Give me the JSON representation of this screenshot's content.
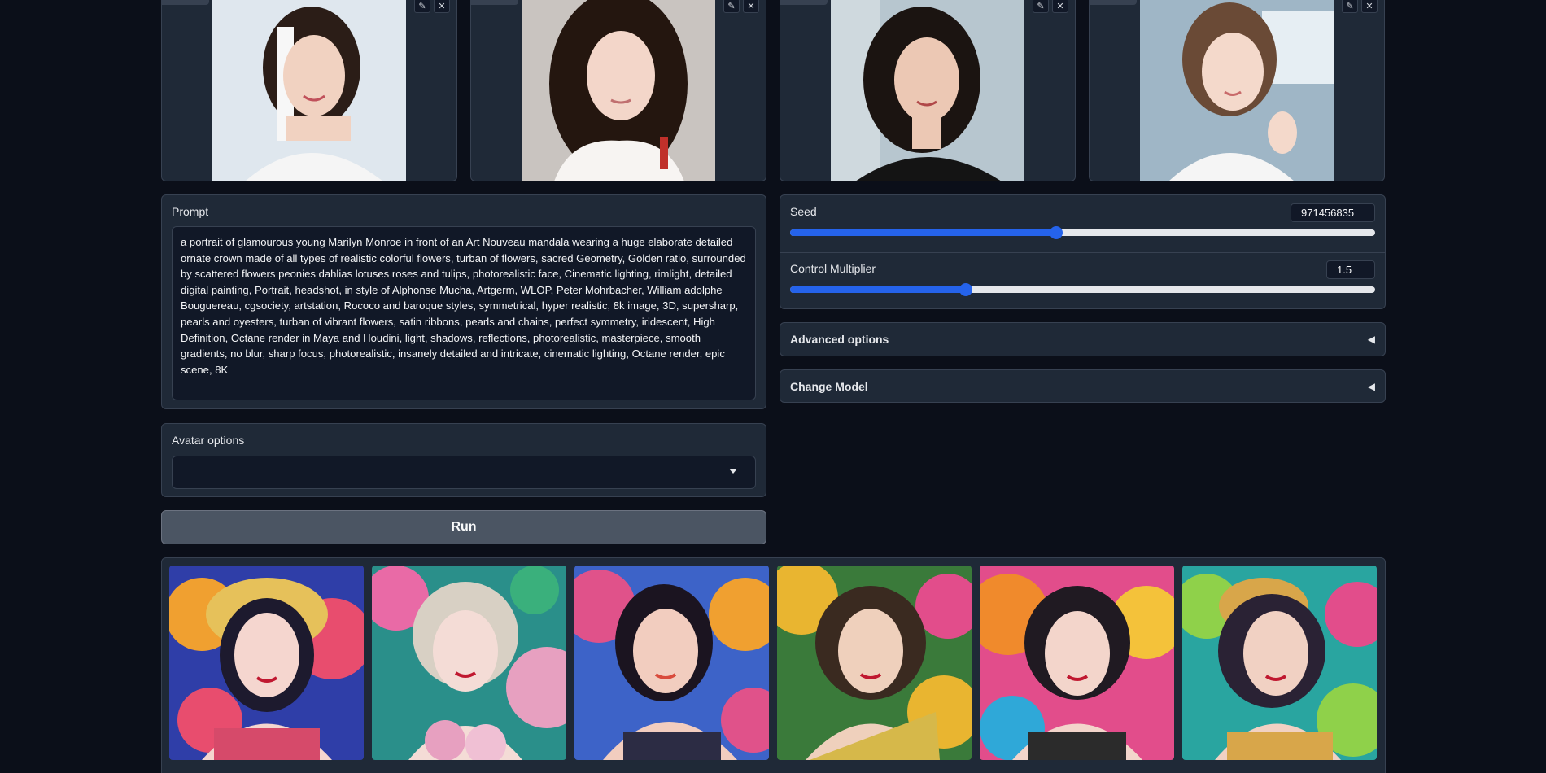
{
  "input_images": [
    {
      "name": "input-photo-1",
      "bg": "#dfe7ee",
      "hair": "#2b1d17",
      "skin": "#f1d2c1",
      "cloth": "#f5f5f5"
    },
    {
      "name": "input-photo-2",
      "bg": "#c9c4c0",
      "hair": "#24160f",
      "skin": "#f3d6c9",
      "cloth": "#f7f4f2"
    },
    {
      "name": "input-photo-3",
      "bg": "#b7c6cf",
      "hair": "#1b1411",
      "skin": "#ecc8b4",
      "cloth": "#141414"
    },
    {
      "name": "input-photo-4",
      "bg": "#9fb6c6",
      "hair": "#6a4a36",
      "skin": "#f4d9cb",
      "cloth": "#f5f5f5"
    }
  ],
  "prompt": {
    "label": "Prompt",
    "value": "a portrait of glamourous young Marilyn Monroe in front of an Art Nouveau mandala wearing a huge elaborate detailed ornate crown made of all types of realistic colorful flowers, turban of flowers, sacred Geometry, Golden ratio, surrounded by scattered flowers peonies dahlias lotuses roses and tulips, photorealistic face, Cinematic lighting, rimlight, detailed digital painting, Portrait, headshot, in style of Alphonse Mucha, Artgerm, WLOP, Peter Mohrbacher, William adolphe Bouguereau, cgsociety, artstation, Rococo and baroque styles, symmetrical, hyper realistic, 8k image, 3D, supersharp, pearls and oyesters, turban of vibrant flowers, satin ribbons, pearls and chains, perfect symmetry, iridescent, High Definition, Octane render in Maya and Houdini, light, shadows, reflections, photorealistic, masterpiece, smooth gradients, no blur, sharp focus, photorealistic, insanely detailed and intricate, cinematic lighting, Octane render, epic scene, 8K"
  },
  "seed": {
    "label": "Seed",
    "value": "971456835",
    "fraction": 0.455
  },
  "control_multiplier": {
    "label": "Control Multiplier",
    "value": "1.5",
    "fraction": 0.3
  },
  "advanced_options": {
    "label": "Advanced options",
    "arrow": "◀"
  },
  "change_model": {
    "label": "Change Model",
    "arrow": "◀"
  },
  "avatar_options": {
    "label": "Avatar options",
    "selected": ""
  },
  "run_button": {
    "label": "Run"
  },
  "gallery": [
    {
      "name": "output-image-1",
      "bg1": "#2f3ea8",
      "bg2": "#f0a030",
      "hair": "#1d1a2e",
      "skin": "#f5d6cf",
      "accent": "#e84d6e"
    },
    {
      "name": "output-image-2",
      "bg1": "#2a8f8a",
      "bg2": "#e96aa6",
      "hair": "#d8d0c4",
      "skin": "#f4dcd6",
      "accent": "#e7a0c0"
    },
    {
      "name": "output-image-3",
      "bg1": "#e0528a",
      "bg2": "#3d63c8",
      "hair": "#1b1420",
      "skin": "#f2cdbf",
      "accent": "#d94b3c"
    },
    {
      "name": "output-image-4",
      "bg1": "#e9b530",
      "bg2": "#3a7a3a",
      "hair": "#3a2a20",
      "skin": "#efd0bc",
      "accent": "#d6b84a"
    },
    {
      "name": "output-image-5",
      "bg1": "#f08a2c",
      "bg2": "#e24d8b",
      "hair": "#201a22",
      "skin": "#f3d5cb",
      "accent": "#2b2b2b"
    },
    {
      "name": "output-image-6",
      "bg1": "#29a5a0",
      "bg2": "#8fd14a",
      "hair": "#2a2234",
      "skin": "#f1d1c3",
      "accent": "#d8a64a"
    }
  ],
  "icons": {
    "edit": "pencil-icon",
    "clear": "close-icon",
    "dropdown": "chevron-down-icon"
  }
}
